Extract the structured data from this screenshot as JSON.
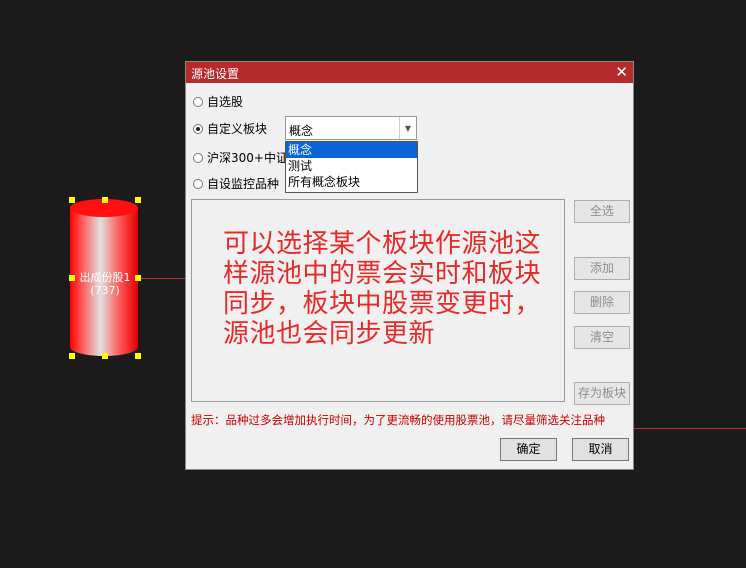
{
  "canvas": {
    "node": {
      "name": "出成份股1",
      "sub": "(737)"
    }
  },
  "dialog": {
    "title": "源池设置",
    "close_glyph": "✕",
    "radios": [
      {
        "label": "自选股",
        "checked": false
      },
      {
        "label": "自定义板块",
        "checked": true
      },
      {
        "label": "沪深300+中证",
        "checked": false
      },
      {
        "label": "自设监控品种",
        "checked": false
      }
    ],
    "combo": {
      "value": "概念",
      "arrow": "▼"
    },
    "dropdown_options": [
      "概念",
      "测试",
      "所有概念板块"
    ],
    "overlay_text": "可以选择某个板块作源池这样源池中的票会实时和板块同步，板块中股票变更时，源池也会同步更新",
    "buttons": {
      "select_all": "全选",
      "add": "添加",
      "delete": "删除",
      "clear": "清空",
      "save_as_block": "存为板块",
      "ok": "确定",
      "cancel": "取消"
    },
    "tip": "提示：品种过多会增加执行时间，为了更流畅的使用股票池，请尽量筛选关注品种"
  },
  "colors": {
    "titlebar": "#b52a2a",
    "accent_text": "#e52a2a",
    "selection": "#0a64d6"
  }
}
